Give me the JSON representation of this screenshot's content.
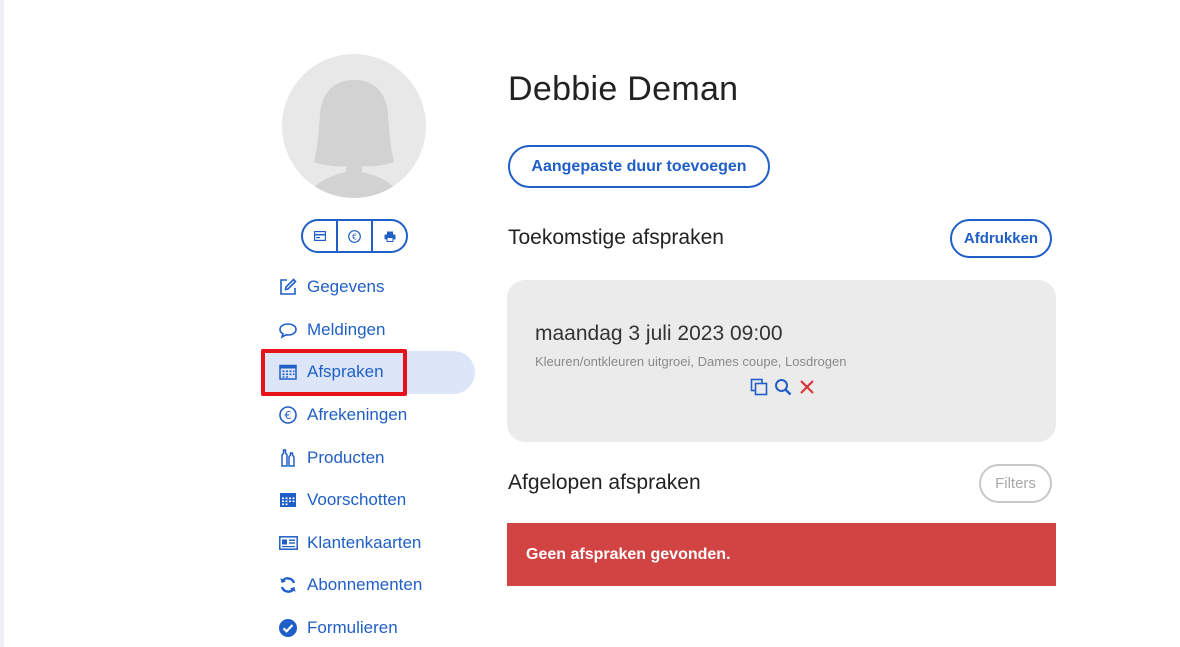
{
  "customer": {
    "name": "Debbie Deman"
  },
  "avatar_icons": [
    "card-icon",
    "euro-icon",
    "print-icon"
  ],
  "nav": {
    "items": [
      {
        "label": "Gegevens",
        "icon": "edit-icon"
      },
      {
        "label": "Meldingen",
        "icon": "chat-icon"
      },
      {
        "label": "Afspraken",
        "icon": "calendar-icon",
        "active": true
      },
      {
        "label": "Afrekeningen",
        "icon": "euro-icon"
      },
      {
        "label": "Producten",
        "icon": "bottles-icon"
      },
      {
        "label": "Voorschotten",
        "icon": "calendar-icon"
      },
      {
        "label": "Klantenkaarten",
        "icon": "card-icon"
      },
      {
        "label": "Abonnementen",
        "icon": "refresh-icon"
      },
      {
        "label": "Formulieren",
        "icon": "check-circle-icon"
      }
    ]
  },
  "actions": {
    "add_duration": "Aangepaste duur toevoegen"
  },
  "upcoming": {
    "title": "Toekomstige afspraken",
    "print_label": "Afdrukken",
    "appointment": {
      "date": "maandag 3 juli 2023 09:00",
      "services": "Kleuren/ontkleuren uitgroei, Dames coupe, Losdrogen"
    }
  },
  "past": {
    "title": "Afgelopen afspraken",
    "filters_label": "Filters",
    "empty_message": "Geen afspraken gevonden."
  },
  "colors": {
    "accent": "#1f5fc7",
    "active_bg": "#dde6f8",
    "danger": "#d24444",
    "highlight": "#e8121b"
  }
}
